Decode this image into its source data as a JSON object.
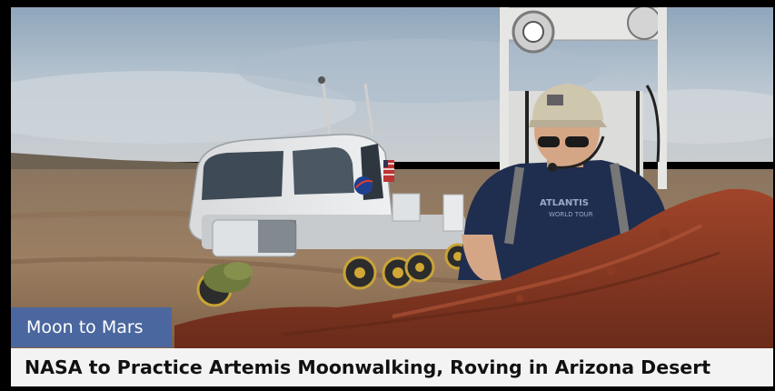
{
  "article": {
    "category": "Moon to Mars",
    "headline": "NASA to Practice Artemis Moonwalking, Roving in Arizona Desert"
  },
  "photo": {
    "subject": "astronaut-with-lunar-rover-in-desert"
  },
  "colors": {
    "category_tag_bg": "#4767a6",
    "headline_bar_bg": "#f3f3f3",
    "headline_text": "#111111"
  }
}
